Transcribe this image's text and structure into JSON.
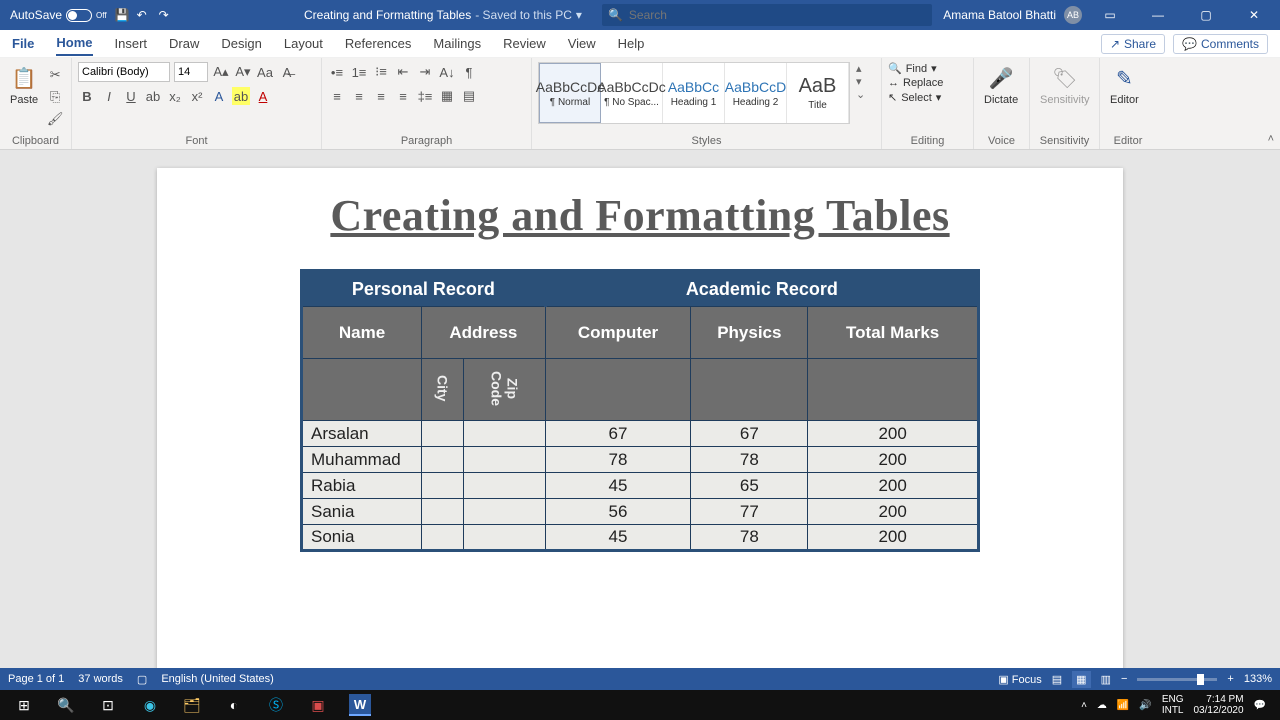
{
  "titlebar": {
    "autosave": "AutoSave",
    "autosave_state": "Off",
    "doc_title": "Creating and Formatting Tables",
    "saved_status": " - Saved to this PC",
    "search_placeholder": "Search",
    "user_name": "Amama Batool Bhatti",
    "user_initials": "AB"
  },
  "menu": {
    "file": "File",
    "home": "Home",
    "insert": "Insert",
    "draw": "Draw",
    "design": "Design",
    "layout": "Layout",
    "references": "References",
    "mailings": "Mailings",
    "review": "Review",
    "view": "View",
    "help": "Help",
    "share": "Share",
    "comments": "Comments"
  },
  "ribbon": {
    "clipboard": "Clipboard",
    "paste": "Paste",
    "font": "Font",
    "font_name": "Calibri (Body)",
    "font_size": "14",
    "paragraph": "Paragraph",
    "styles": "Styles",
    "style_preview": "AaBbCcDc",
    "style_preview_big": "AaB",
    "style_normal": "¶ Normal",
    "style_nospace": "¶ No Spac...",
    "style_h1_prev": "AaBbCc",
    "style_h1": "Heading 1",
    "style_h2_prev": "AaBbCcD",
    "style_h2": "Heading 2",
    "style_title": "Title",
    "editing": "Editing",
    "find": "Find",
    "replace": "Replace",
    "select": "Select",
    "voice": "Voice",
    "dictate": "Dictate",
    "sensitivity": "Sensitivity",
    "sensitivity_btn": "Sensitivity",
    "editor": "Editor",
    "editor_btn": "Editor"
  },
  "document": {
    "heading": "Creating and Formatting Tables",
    "table": {
      "header_groups": [
        "Personal Record",
        "Academic Record"
      ],
      "sub_headers": [
        "Name",
        "Address",
        "Computer",
        "Physics",
        "Total Marks"
      ],
      "address_sub": [
        "City",
        "Zip Code"
      ],
      "rows": [
        {
          "name": "Arsalan",
          "city": "",
          "zip": "",
          "computer": "67",
          "physics": "67",
          "total": "200"
        },
        {
          "name": "Muhammad",
          "city": "",
          "zip": "",
          "computer": "78",
          "physics": "78",
          "total": "200"
        },
        {
          "name": "Rabia",
          "city": "",
          "zip": "",
          "computer": "45",
          "physics": "65",
          "total": "200"
        },
        {
          "name": "Sania",
          "city": "",
          "zip": "",
          "computer": "56",
          "physics": "77",
          "total": "200"
        },
        {
          "name": "Sonia",
          "city": "",
          "zip": "",
          "computer": "45",
          "physics": "78",
          "total": "200"
        }
      ]
    }
  },
  "statusbar": {
    "page": "Page 1 of 1",
    "words": "37 words",
    "lang": "English (United States)",
    "focus": "Focus",
    "zoom": "133%"
  },
  "taskbar": {
    "lang1": "ENG",
    "lang2": "INTL",
    "time": "7:14 PM",
    "date": "03/12/2020"
  }
}
